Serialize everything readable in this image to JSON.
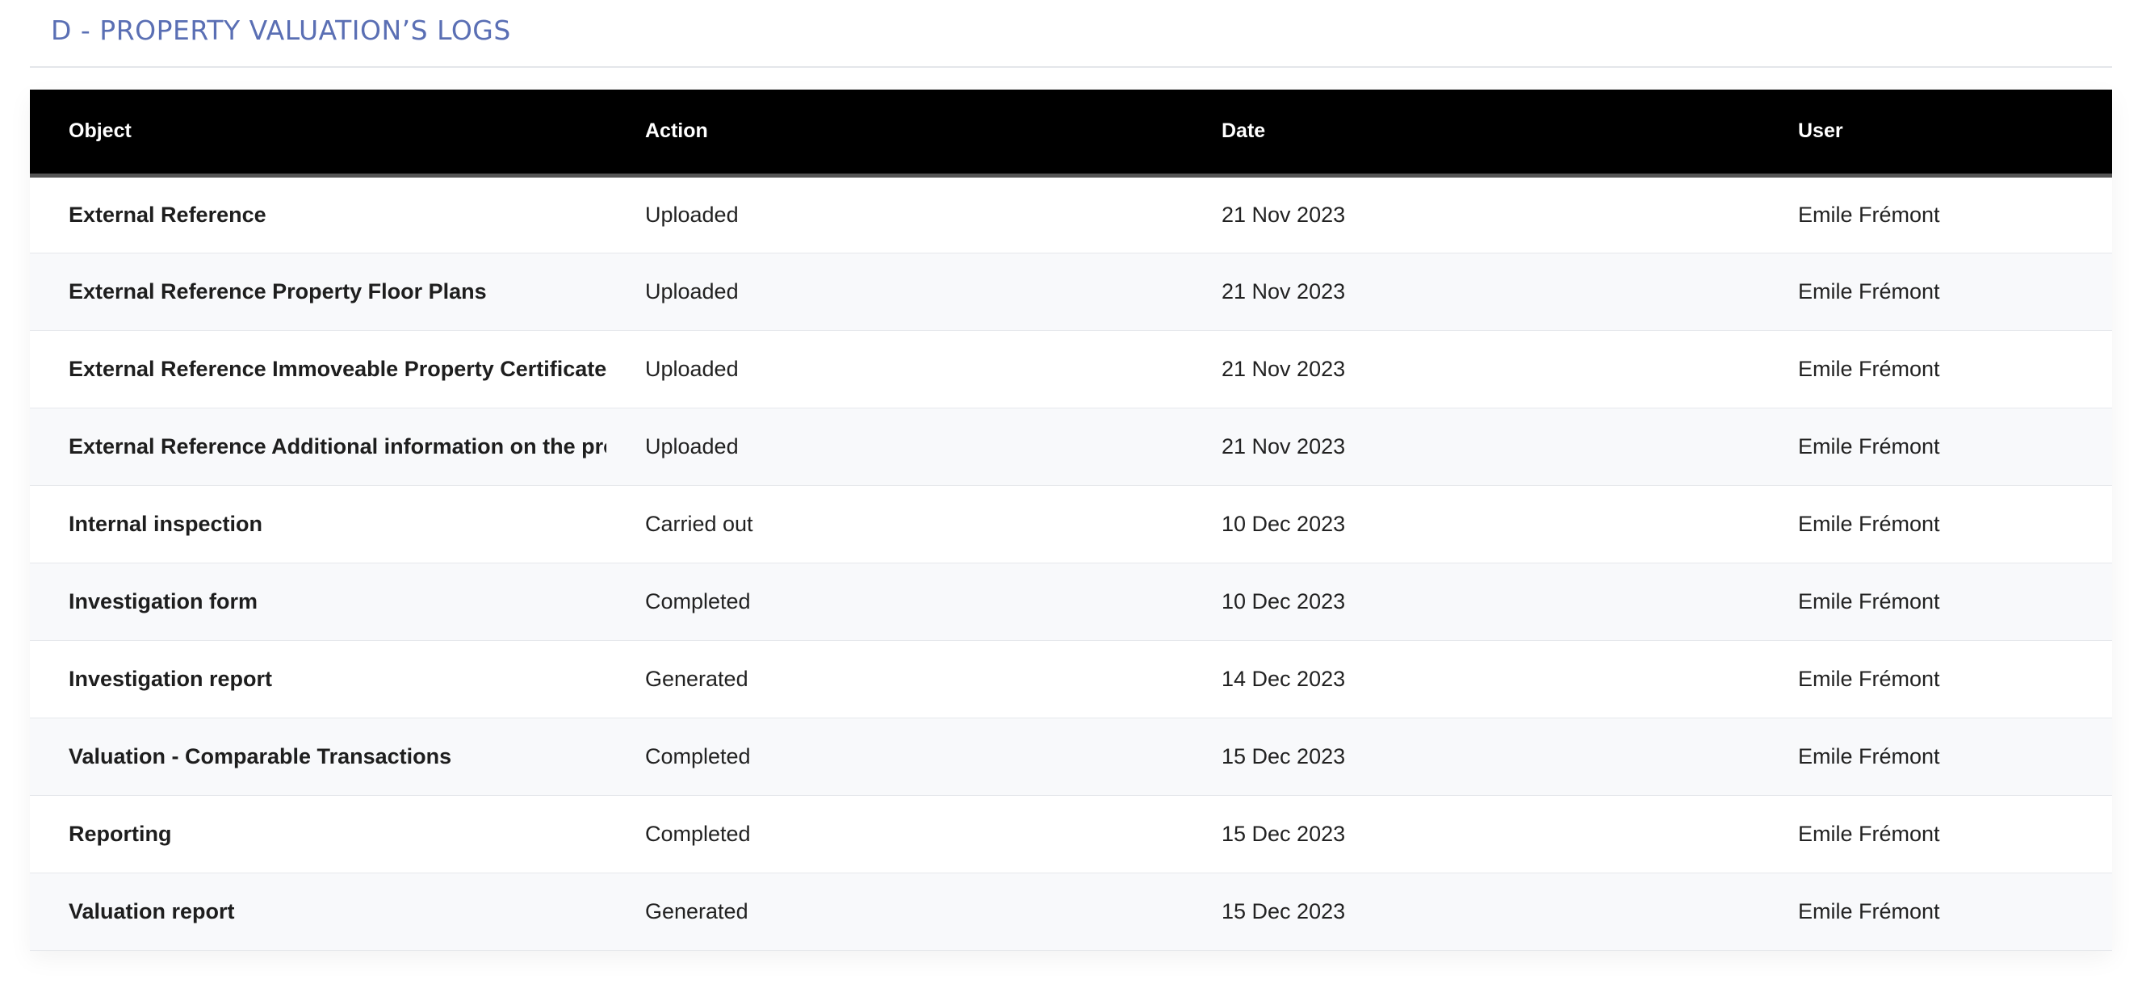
{
  "section": {
    "title": "D - PROPERTY VALUATION’S LOGS",
    "title_color": "#5a6fb4"
  },
  "table": {
    "header_background": "#000000",
    "columns": [
      "Object",
      "Action",
      "Date",
      "User"
    ],
    "rows": [
      {
        "object": "External Reference",
        "action": "Uploaded",
        "date": "21 Nov 2023",
        "user": "Emile Frémont"
      },
      {
        "object": "External Reference Property Floor Plans",
        "action": "Uploaded",
        "date": "21 Nov 2023",
        "user": "Emile Frémont"
      },
      {
        "object": "External Reference Immoveable Property Certificate",
        "action": "Uploaded",
        "date": "21 Nov 2023",
        "user": "Emile Frémont"
      },
      {
        "object": "External Reference Additional information on the property",
        "action": "Uploaded",
        "date": "21 Nov 2023",
        "user": "Emile Frémont"
      },
      {
        "object": "Internal inspection",
        "action": "Carried out",
        "date": "10 Dec 2023",
        "user": "Emile Frémont"
      },
      {
        "object": "Investigation form",
        "action": "Completed",
        "date": "10 Dec 2023",
        "user": "Emile Frémont"
      },
      {
        "object": "Investigation report",
        "action": "Generated",
        "date": "14 Dec 2023",
        "user": "Emile Frémont"
      },
      {
        "object": "Valuation - Comparable Transactions",
        "action": "Completed",
        "date": "15 Dec 2023",
        "user": "Emile Frémont"
      },
      {
        "object": "Reporting",
        "action": "Completed",
        "date": "15 Dec 2023",
        "user": "Emile Frémont"
      },
      {
        "object": "Valuation report",
        "action": "Generated",
        "date": "15 Dec 2023",
        "user": "Emile Frémont"
      }
    ]
  }
}
